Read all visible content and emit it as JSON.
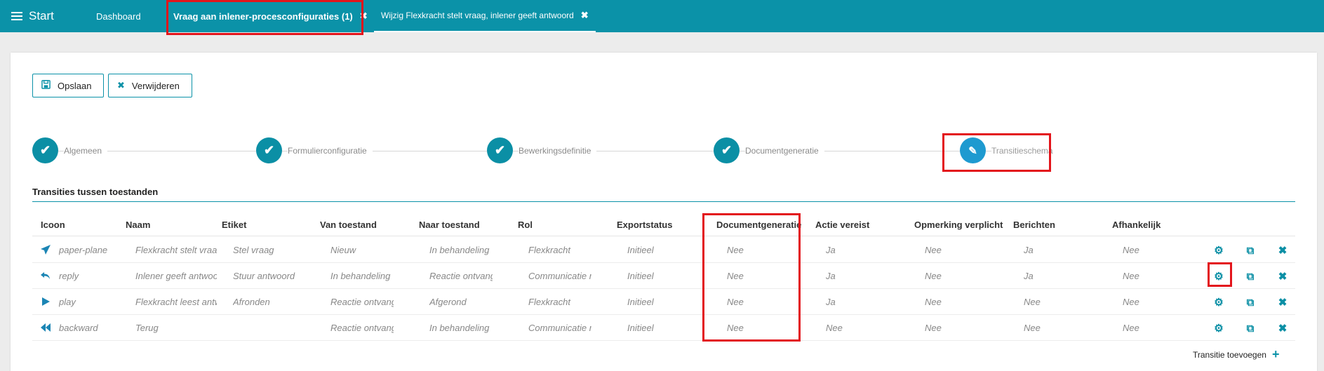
{
  "topbar": {
    "start_label": "Start",
    "tabs": [
      {
        "label": "Dashboard"
      },
      {
        "label": "Vraag aan inlener-procesconfiguraties (1)",
        "close": "✖"
      },
      {
        "label": "Wijzig Flexkracht stelt vraag, inlener geeft antwoord",
        "close": "✖"
      }
    ]
  },
  "toolbar": {
    "save_label": "Opslaan",
    "delete_label": "Verwijderen"
  },
  "stepper": {
    "steps": [
      {
        "label": "Algemeen",
        "icon": "check-icon"
      },
      {
        "label": "Formulierconfiguratie",
        "icon": "check-icon"
      },
      {
        "label": "Bewerkingsdefinitie",
        "icon": "check-icon"
      },
      {
        "label": "Documentgeneratie",
        "icon": "check-icon"
      },
      {
        "label": "Transitieschema",
        "icon": "pencil-icon"
      }
    ]
  },
  "section": {
    "title": "Transities tussen toestanden"
  },
  "table": {
    "columns": [
      "Icoon",
      "Naam",
      "Etiket",
      "Van toestand",
      "Naar toestand",
      "Rol",
      "Exportstatus",
      "Documentgeneratie",
      "Actie vereist",
      "Opmerking verplicht",
      "Berichten",
      "Afhankelijk"
    ],
    "rows": [
      {
        "icon": "paper-plane",
        "naam": "Flexkracht stelt vraag",
        "etiket": "Stel vraag",
        "van": "Nieuw",
        "naar": "In behandeling",
        "rol": "Flexkracht",
        "export": "Initieel",
        "docgen": "Nee",
        "actie": "Ja",
        "opmerking": "Nee",
        "berichten": "Ja",
        "afhankelijk": "Nee"
      },
      {
        "icon": "reply",
        "naam": "Inlener geeft antwoord",
        "etiket": "Stuur antwoord",
        "van": "In behandeling",
        "naar": "Reactie ontvangen",
        "rol": "Communicatie medewerker",
        "export": "Initieel",
        "docgen": "Nee",
        "actie": "Ja",
        "opmerking": "Nee",
        "berichten": "Ja",
        "afhankelijk": "Nee"
      },
      {
        "icon": "play",
        "naam": "Flexkracht leest antwoord",
        "etiket": "Afronden",
        "van": "Reactie ontvangen",
        "naar": "Afgerond",
        "rol": "Flexkracht",
        "export": "Initieel",
        "docgen": "Nee",
        "actie": "Ja",
        "opmerking": "Nee",
        "berichten": "Nee",
        "afhankelijk": "Nee"
      },
      {
        "icon": "backward",
        "naam": "Terug",
        "etiket": "",
        "van": "Reactie ontvangen",
        "naar": "In behandeling",
        "rol": "Communicatie medewerker",
        "export": "Initieel",
        "docgen": "Nee",
        "actie": "Nee",
        "opmerking": "Nee",
        "berichten": "Nee",
        "afhankelijk": "Nee"
      }
    ],
    "add_label": "Transitie toevoegen"
  },
  "colors": {
    "brand": "#0b92a8",
    "highlight": "#e3151c",
    "row_icon": "#1b85b4"
  }
}
